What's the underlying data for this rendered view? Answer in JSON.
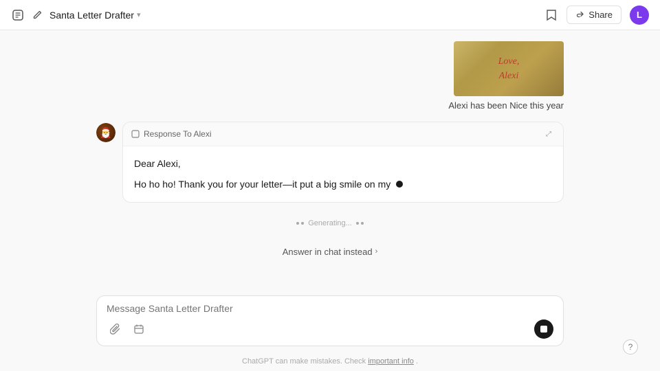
{
  "header": {
    "edit_icon": "✏",
    "title": "Santa Letter Drafter",
    "chevron": "▾",
    "bookmark_label": "Bookmark",
    "share_label": "Share",
    "avatar_letter": "L"
  },
  "chat": {
    "user_image_alt": "Letter from Alexi",
    "letter_line1": "Love,",
    "letter_line2": "Alexi",
    "user_caption": "Alexi has been Nice this year",
    "assistant_bubble_title": "Response To Alexi",
    "expand_icon": "⤢",
    "dear_text": "Dear Alexi,",
    "body_text": "Ho ho ho! Thank you for your letter—it put a big smile on my",
    "generating_text": "Generating...",
    "answer_in_chat": "Answer in chat instead",
    "answer_chevron": "›"
  },
  "input": {
    "placeholder": "Message Santa Letter Drafter",
    "paperclip_icon": "paperclip",
    "calendar_icon": "calendar"
  },
  "footer": {
    "text": "ChatGPT can make mistakes. Check",
    "link_text": "important info",
    "period": ".",
    "help": "?"
  }
}
